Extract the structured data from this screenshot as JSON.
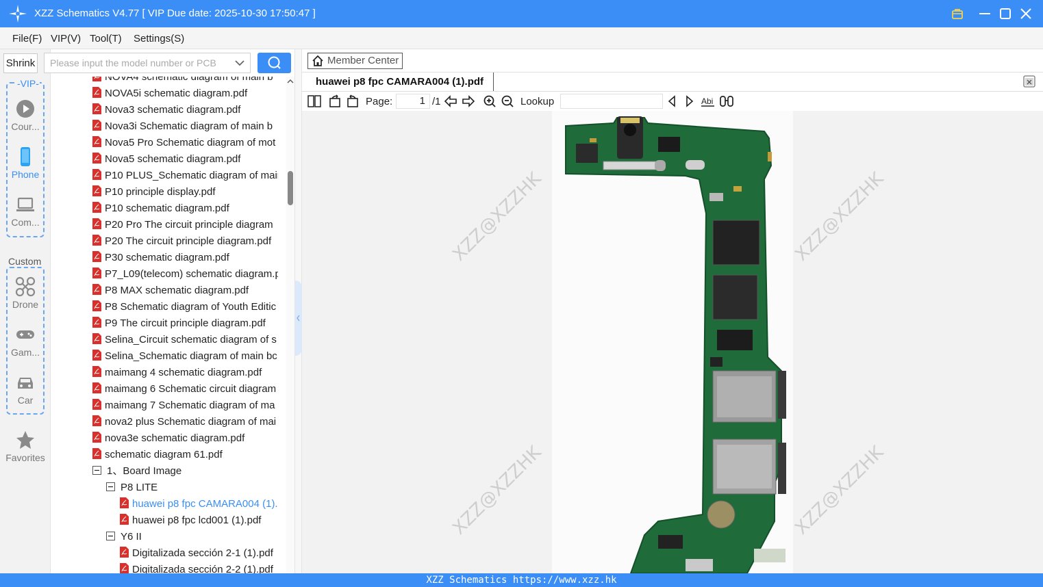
{
  "window": {
    "title": "XZZ Schematics V4.77 [ VIP Due date: 2025-10-30 17:50:47 ]"
  },
  "menu": {
    "items": [
      "File(F)",
      "VIP(V)",
      "Tool(T)",
      "Settings(S)"
    ]
  },
  "sidebar": {
    "shrink_label": "Shrink",
    "vip_group_label": "VIP",
    "custom_group_label": "Custom",
    "items": [
      {
        "label": "Cour...",
        "icon": "play-circle-icon"
      },
      {
        "label": "Phone",
        "icon": "phone-icon",
        "active": true
      },
      {
        "label": "Com...",
        "icon": "laptop-icon"
      },
      {
        "label": "Drone",
        "icon": "drone-icon"
      },
      {
        "label": "Gam...",
        "icon": "gamepad-icon"
      },
      {
        "label": "Car",
        "icon": "car-icon"
      },
      {
        "label": "Favorites",
        "icon": "star-icon"
      }
    ]
  },
  "search": {
    "placeholder": "Please input the model number or PCB",
    "value": ""
  },
  "tree": {
    "files": [
      "NOVA4 schematic diagram of main b",
      "NOVA5i schematic diagram.pdf",
      "Nova3 schematic diagram.pdf",
      "Nova3i Schematic diagram of main b",
      "Nova5 Pro Schematic diagram of mot",
      "Nova5 schematic diagram.pdf",
      "P10 PLUS_Schematic diagram of mair",
      "P10 principle display.pdf",
      "P10 schematic diagram.pdf",
      "P20 Pro The circuit principle diagram",
      "P20 The circuit principle diagram.pdf",
      "P30 schematic diagram.pdf",
      "P7_L09(telecom) schematic diagram.p",
      "P8 MAX schematic diagram.pdf",
      "P8 Schematic diagram of Youth Editic",
      "P9 The circuit principle diagram.pdf",
      "Selina_Circuit schematic diagram of s",
      "Selina_Schematic diagram of main bc",
      "maimang 4 schematic diagram.pdf",
      "maimang 6 Schematic circuit diagram",
      "maimang 7 Schematic diagram of ma",
      "nova2 plus Schematic diagram of mai",
      "nova3e schematic diagram.pdf",
      "schematic diagram 61.pdf"
    ],
    "board_image_folder": "1、Board Image",
    "p8_lite_folder": "P8 LITE",
    "p8_lite_files": [
      "huawei p8 fpc CAMARA004 (1).",
      "huawei p8 fpc lcd001 (1).pdf"
    ],
    "y6_folder": "Y6 II",
    "y6_files": [
      "Digitalizada sección 2-1 (1).pdf",
      "Digitalizada sección 2-2 (1).pdf"
    ]
  },
  "viewer": {
    "member_center_label": "Member Center",
    "tab_title": "huawei p8 fpc CAMARA004 (1).pdf",
    "page_label": "Page:",
    "page_current": "1",
    "page_total": "/1",
    "lookup_label": "Lookup",
    "lookup_value": "",
    "watermark": "XZZ@XZZHK"
  },
  "status": {
    "text": "XZZ Schematics https://www.xzz.hk"
  },
  "colors": {
    "accent": "#3a8ef6",
    "pcb_green": "#1f6b3a",
    "pdf_red": "#d9302c"
  }
}
